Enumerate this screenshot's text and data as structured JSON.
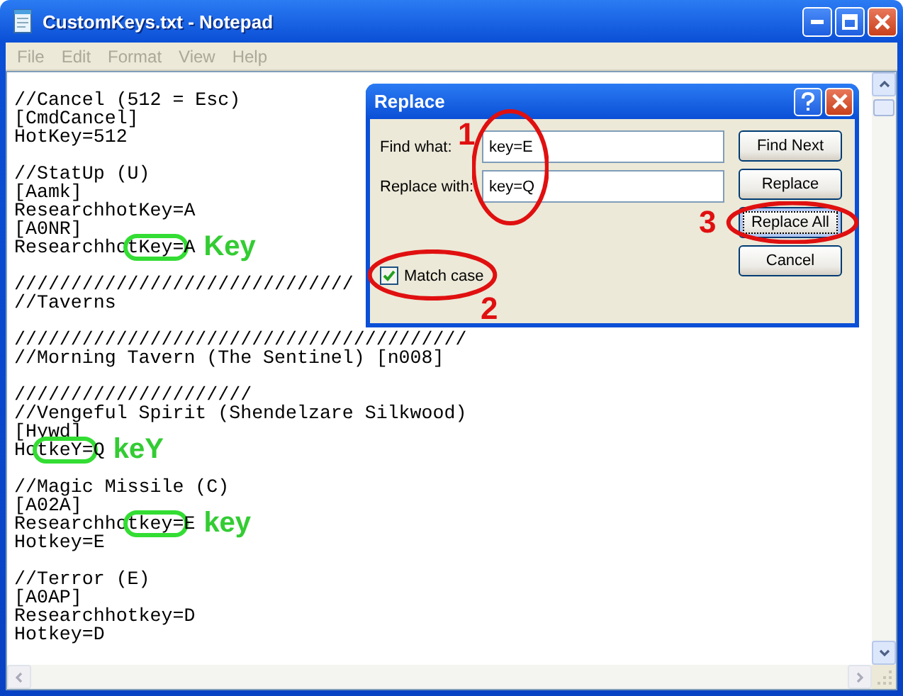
{
  "window": {
    "title": "CustomKeys.txt - Notepad"
  },
  "menu": [
    {
      "label": "File"
    },
    {
      "label": "Edit"
    },
    {
      "label": "Format"
    },
    {
      "label": "View"
    },
    {
      "label": "Help"
    }
  ],
  "editor": {
    "lines": [
      {
        "text": "//Cancel (512 = Esc)"
      },
      {
        "text": "[CmdCancel]"
      },
      {
        "text": "HotKey=512"
      },
      {
        "text": "//StatUp (U)",
        "gap_before": true
      },
      {
        "text": "[Aamk]"
      },
      {
        "text": "ResearchhotKey=A"
      },
      {
        "text": "[A0NR]"
      },
      {
        "text": "Researchho",
        "marked": "tKey=",
        "rest": "A",
        "note": "Key"
      },
      {
        "text": "//////////////////////////////",
        "gap_before": true
      },
      {
        "text": "//Taverns"
      },
      {
        "text": "////////////////////////////////////////",
        "gap_before": true
      },
      {
        "text": "//Morning Tavern (The Sentinel) [n008]"
      },
      {
        "text": "/////////////////////",
        "gap_before": true
      },
      {
        "text": "//Vengeful Spirit (Shendelzare Silkwood)"
      },
      {
        "text": "[Hywd]"
      },
      {
        "text": "Ho",
        "marked": "tkeY=",
        "rest": "Q",
        "note": "keY"
      },
      {
        "text": "//Magic Missile (C)",
        "gap_before": true
      },
      {
        "text": "[A02A]"
      },
      {
        "text": "Researchho",
        "marked": "tkey=",
        "rest": "E",
        "note": "key"
      },
      {
        "text": "Hotkey=E"
      },
      {
        "text": "//Terror (E)",
        "gap_before": true
      },
      {
        "text": "[A0AP]"
      },
      {
        "text": "Researchhotkey=D"
      },
      {
        "text": "Hotkey=D"
      }
    ]
  },
  "dialog": {
    "title": "Replace",
    "fields": [
      {
        "label": "Find what:",
        "value": "key=E"
      },
      {
        "label": "Replace with:",
        "value": "key=Q"
      }
    ],
    "checkbox": {
      "label": "Match case",
      "checked": true
    },
    "buttons": [
      {
        "label": "Find Next",
        "focused": false
      },
      {
        "label": "Replace",
        "focused": false
      },
      {
        "label": "Replace All",
        "focused": true
      },
      {
        "label": "Cancel",
        "focused": false
      }
    ],
    "callouts": [
      {
        "label": "1"
      },
      {
        "label": "2"
      },
      {
        "label": "3"
      }
    ]
  }
}
